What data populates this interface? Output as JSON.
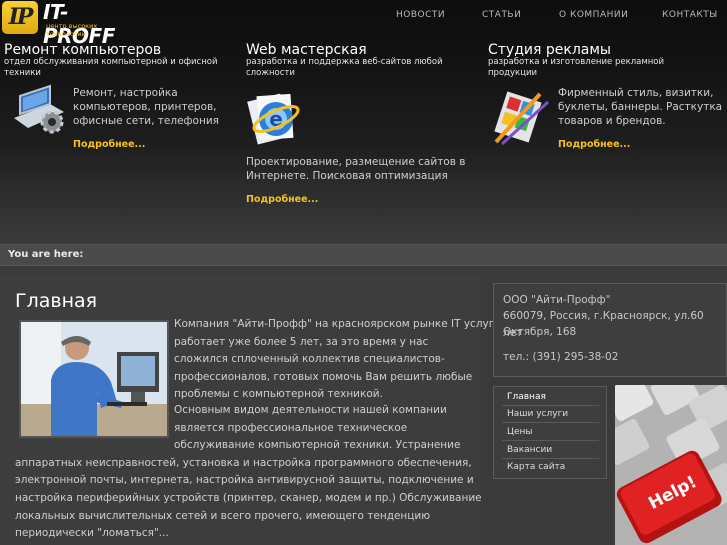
{
  "logo": {
    "badge": "IP",
    "title": "IT-PROFF",
    "subtitle": "центр высоких технологий"
  },
  "nav": [
    "НОВОСТИ",
    "СТАТЬИ",
    "О КОМПАНИИ",
    "КОНТАКТЫ"
  ],
  "services": [
    {
      "title": "Ремонт компьютеров",
      "subtitle_lines": [
        "отдел обслуживания компьютерной и офисной",
        "техники"
      ],
      "text_lines": [
        "Ремонт, настройка",
        "компьютеров, принтеров,",
        "офисные сети, телефония"
      ],
      "more": "Подробнее...",
      "icon": "laptop-gear-icon"
    },
    {
      "title": "Web мастерская",
      "subtitle_lines": [
        "разработка и поддержка веб-сайтов любой",
        "сложности"
      ],
      "text_lines": [
        "Проектирование, размещение сайтов в",
        "Интернете. Поисковая оптимизация"
      ],
      "more": "Подробнее...",
      "icon": "internet-explorer-icon"
    },
    {
      "title": "Студия рекламы",
      "subtitle_lines": [
        "разработка и изготовление рекламной",
        "продукции"
      ],
      "text_lines": [
        "Фирменный стиль, визитки,",
        "буклеты, баннеры. Расткутка",
        "товаров и брендов."
      ],
      "more": "Подробнее...",
      "icon": "design-tools-icon"
    }
  ],
  "breadcrumb": "You are here:",
  "main": {
    "title": "Главная",
    "para1_lines": [
      "Компания \"Айти-Профф\" на красноярском рынке IT услуг",
      "работает уже более 5 лет, за это время у нас",
      "сложился сплоченный коллектив специалистов-",
      "профессионалов, готовых помочь Вам решить любые",
      "проблемы с компьютерной техникой."
    ],
    "para2_lines": [
      "Основным видом деятельности нашей компании",
      "является профессиональное техническое",
      "обслуживание компьютерной техники. Устранение",
      "аппаратных неисправностей, установка и настройка программного обеспечения,",
      "электронной почты, интернета, настройка антивирусной защиты, подключение и",
      "настройка периферийных устройств (принтер, сканер, модем и пр.) Обслуживание",
      "локальных вычислительных сетей и всего прочего, имеющего тенденцию",
      "периодически \"ломаться\"..."
    ]
  },
  "contact": {
    "lines": [
      "ООО \"Айти-Профф\"",
      "660079, Россия, г.Красноярск, ул.60 лет",
      "Октября, 168"
    ],
    "phone": "тел.: (391) 295-38-02"
  },
  "side_menu": [
    "Главная",
    "Наши услуги",
    "Цены",
    "Вакансии",
    "Карта сайта"
  ],
  "keyboard_key": "Help!",
  "colors": {
    "accent": "#f3c21e",
    "background": "#3a3a3a"
  }
}
